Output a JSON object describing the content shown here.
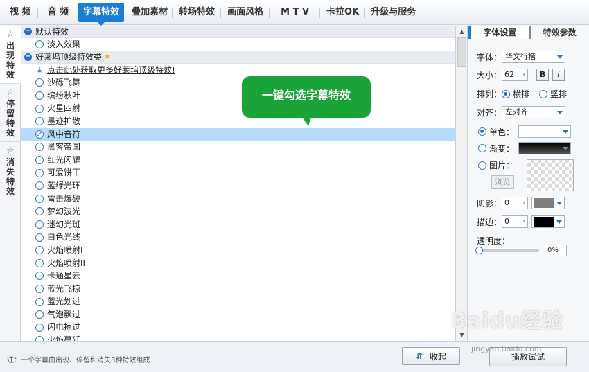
{
  "top_tabs": [
    {
      "label": "视 频"
    },
    {
      "label": "音 频"
    },
    {
      "label": "字幕特效"
    },
    {
      "label": "叠加素材"
    },
    {
      "label": "转场特效"
    },
    {
      "label": "画面风格"
    },
    {
      "label": "M T V"
    },
    {
      "label": "卡拉OK"
    },
    {
      "label": "升级与服务"
    }
  ],
  "side_tabs": [
    {
      "label": "出现特效"
    },
    {
      "label": "停留特效"
    },
    {
      "label": "消失特效"
    }
  ],
  "groups": {
    "default_title": "默认特效",
    "default_item": "淡入效果",
    "hollywood_title": "好莱坞顶级特效类",
    "promo": "点击此处获取更多好莱坞顶级特效!"
  },
  "effects": [
    "沙砾飞舞",
    "缤纷秋叶",
    "火星四射",
    "墨迹扩散",
    "风中音符",
    "黑客帝国",
    "红光闪耀",
    "可爱饼干",
    "蓝绿光环",
    "雷击爆破",
    "梦幻波光",
    "迷幻光斑",
    "白色光线",
    "火焰喷射I",
    "火焰喷射II",
    "卡通星云",
    "蓝光飞掠",
    "蓝光划过",
    "气泡飘过",
    "闪电掠过",
    "火焰蔓延"
  ],
  "selected_effect": "风中音符",
  "callout": "一键勾选字幕特效",
  "right_panel": {
    "tabs": [
      "字体设置",
      "特效参数"
    ],
    "font_label": "字体：",
    "font_value": "华文行楷",
    "size_label": "大小：",
    "size_value": "62",
    "bold": "B",
    "italic": "I",
    "arrange_label": "排列：",
    "arrange_h": "横排",
    "arrange_v": "竖排",
    "align_label": "对齐：",
    "align_value": "左对齐",
    "solid_label": "单色：",
    "gradient_label": "渐变：",
    "image_label": "图片：",
    "browse": "浏览",
    "shadow_label": "阴影：",
    "shadow_value": "0",
    "stroke_label": "描边：",
    "stroke_value": "0",
    "opacity_label": "透明度：",
    "opacity_value": "0%",
    "colors": {
      "accent": "#1a7fd4",
      "shadow_color": "#7f7f7f",
      "stroke_color": "#000000"
    }
  },
  "bottom": {
    "note": "注：一个字幕由出现、停留和消失3种特效组成",
    "collapse": "收起",
    "play": "播放试试"
  },
  "watermark": {
    "logo": "Baidu经验",
    "url": "jingyan.baidu.com"
  }
}
